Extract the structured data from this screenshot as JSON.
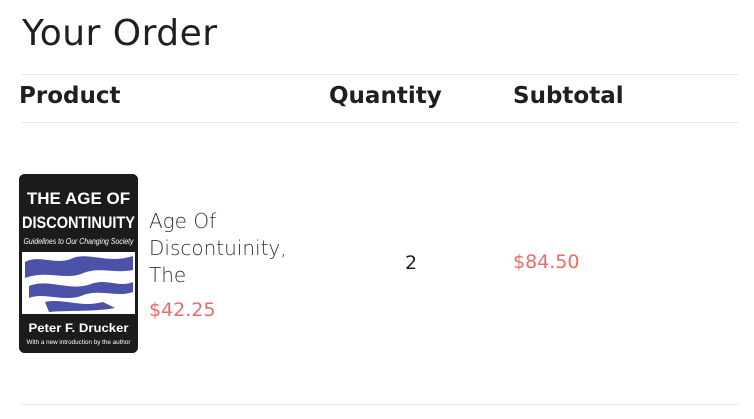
{
  "page": {
    "title": "Your Order"
  },
  "table": {
    "headers": {
      "product": "Product",
      "quantity": "Quantity",
      "subtotal": "Subtotal"
    },
    "rows": [
      {
        "name": "Age Of Discontuinity, The",
        "unit_price": "$42.25",
        "quantity": "2",
        "subtotal": "$84.50",
        "cover": {
          "title_line1": "THE AGE OF",
          "title_line2": "DISCONTINUITY",
          "subtitle": "Guidelines to Our Changing Society",
          "author": "Peter F. Drucker",
          "note": "With a new introduction by the author"
        }
      }
    ]
  },
  "colors": {
    "price": "#e96b6b",
    "divider": "#e6e6e6",
    "cover_background": "#1b1b1b",
    "cover_artwork": "#4b52a8"
  }
}
